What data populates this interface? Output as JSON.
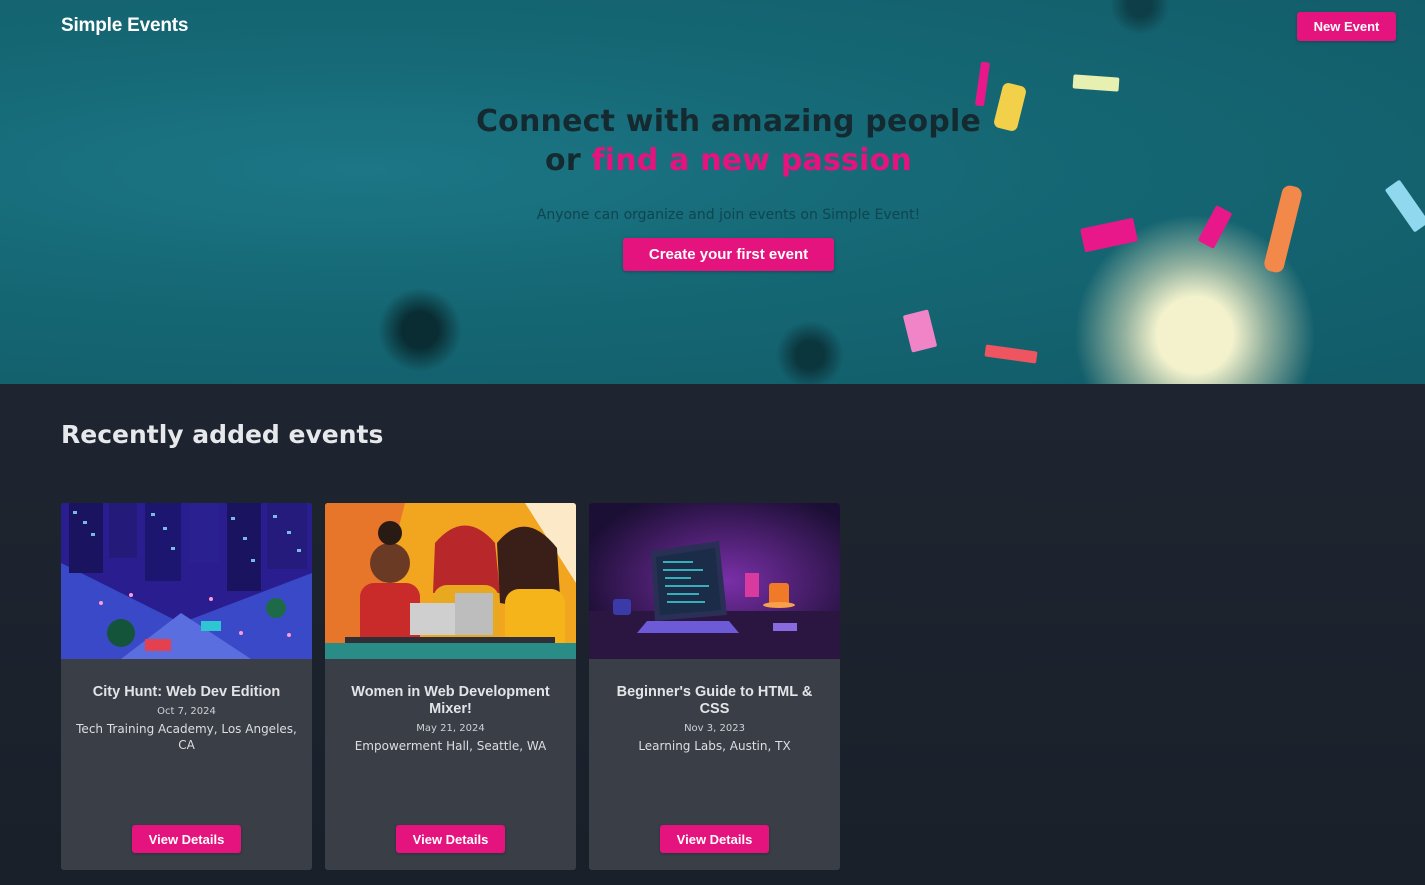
{
  "header": {
    "brand": "Simple Events",
    "new_event_label": "New Event"
  },
  "hero": {
    "title_line1": "Connect with amazing people",
    "title_or": "or",
    "title_accent": "find a new passion",
    "subtitle": "Anyone can organize and join events on Simple Event!",
    "cta_label": "Create your first event"
  },
  "events_section": {
    "title": "Recently added events",
    "events": [
      {
        "title": "City Hunt: Web Dev Edition",
        "date": "Oct 7, 2024",
        "location": "Tech Training Academy, Los Angeles, CA",
        "button_label": "View Details"
      },
      {
        "title": "Women in Web Development Mixer!",
        "date": "May 21, 2024",
        "location": "Empowerment Hall, Seattle, WA",
        "button_label": "View Details"
      },
      {
        "title": "Beginner's Guide to HTML & CSS",
        "date": "Nov 3, 2023",
        "location": "Learning Labs, Austin, TX",
        "button_label": "View Details"
      }
    ]
  },
  "colors": {
    "accent": "#e5137d",
    "hero_bg": "#156774",
    "page_bg": "#1b212b",
    "card_bg": "#3a3f47"
  }
}
